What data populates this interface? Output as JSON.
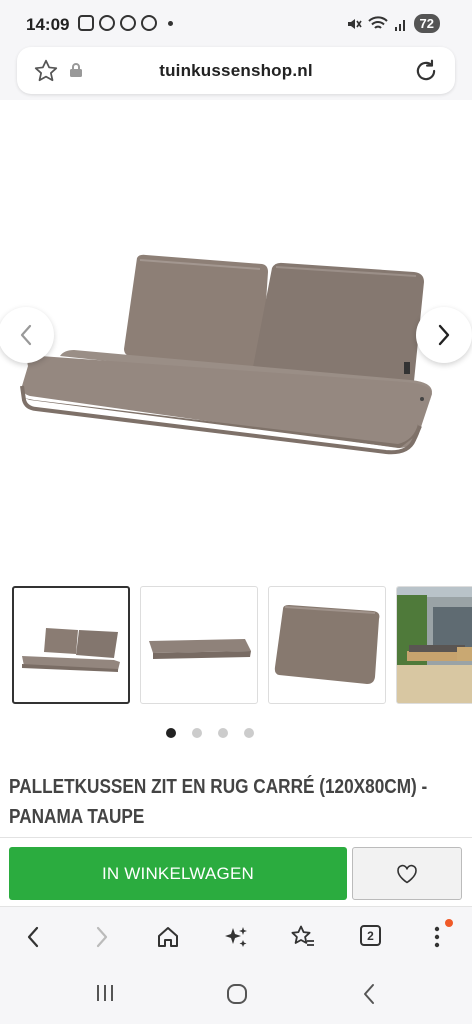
{
  "status_bar": {
    "time": "14:09",
    "battery": "72",
    "left_icons": [
      "screenshot-icon",
      "data-icon",
      "pinterest-icon",
      "whatsapp-icon"
    ],
    "right_icons": [
      "mute-icon",
      "wifi-icon",
      "signal-icon"
    ]
  },
  "browser": {
    "url": "tuinkussenshop.nl",
    "tab_count": "2"
  },
  "product": {
    "title_line1": "PALLETKUSSEN ZIT EN RUG CARRÉ (120X80CM) -",
    "title_line2": "PANAMA TAUPE",
    "add_to_cart_label": "IN WINKELWAGEN",
    "gallery": {
      "count": 4,
      "active_index": 0,
      "thumbnails": [
        "seat-and-back-cushions",
        "seat-cushion",
        "back-cushion",
        "patio-scene"
      ]
    }
  },
  "colors": {
    "cart_green": "#2bac3f",
    "cushion_taupe": "#8d7f76",
    "notification_orange": "#f05a28"
  }
}
